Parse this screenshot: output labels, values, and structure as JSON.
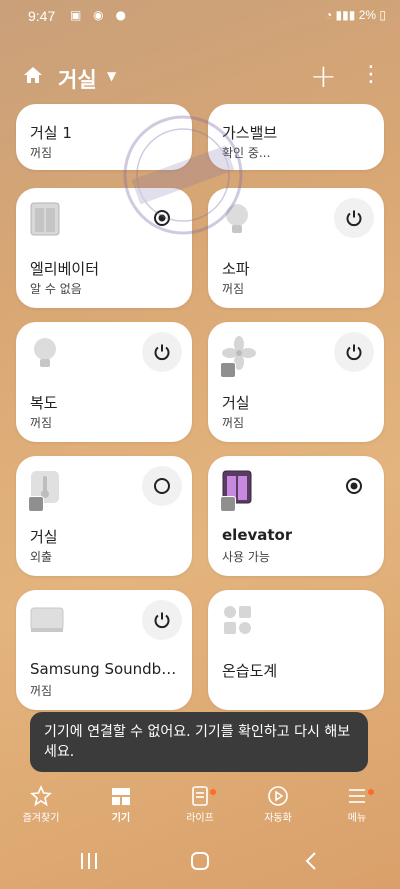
{
  "status_bar": {
    "time": "9:47",
    "battery": "2%"
  },
  "header": {
    "title": "거실"
  },
  "devices": [
    {
      "name": "거실 1",
      "status": "꺼짐"
    },
    {
      "name": "가스밸브",
      "status": "확인 중..."
    },
    {
      "name": "엘리베이터",
      "status": "알 수 없음"
    },
    {
      "name": "소파",
      "status": "꺼짐"
    },
    {
      "name": "복도",
      "status": "꺼짐"
    },
    {
      "name": "거실",
      "status": "꺼짐"
    },
    {
      "name": "거실",
      "status": "외출"
    },
    {
      "name": "elevator",
      "status": "사용 가능"
    },
    {
      "name": "Samsung Soundbar...",
      "status": "꺼짐"
    },
    {
      "name": "온습도계",
      "status": ""
    }
  ],
  "toast": {
    "text": "기기에 연결할 수 없어요. 기기를 확인하고 다시 해보세요."
  },
  "bottom_nav": [
    {
      "label": "즐겨찾기"
    },
    {
      "label": "기기"
    },
    {
      "label": "라이프"
    },
    {
      "label": "자동화"
    },
    {
      "label": "메뉴"
    }
  ],
  "colors": {
    "notification_dot": "#ff6a2a",
    "card_bg": "#ffffff",
    "toast_bg": "#3b3b3b"
  }
}
